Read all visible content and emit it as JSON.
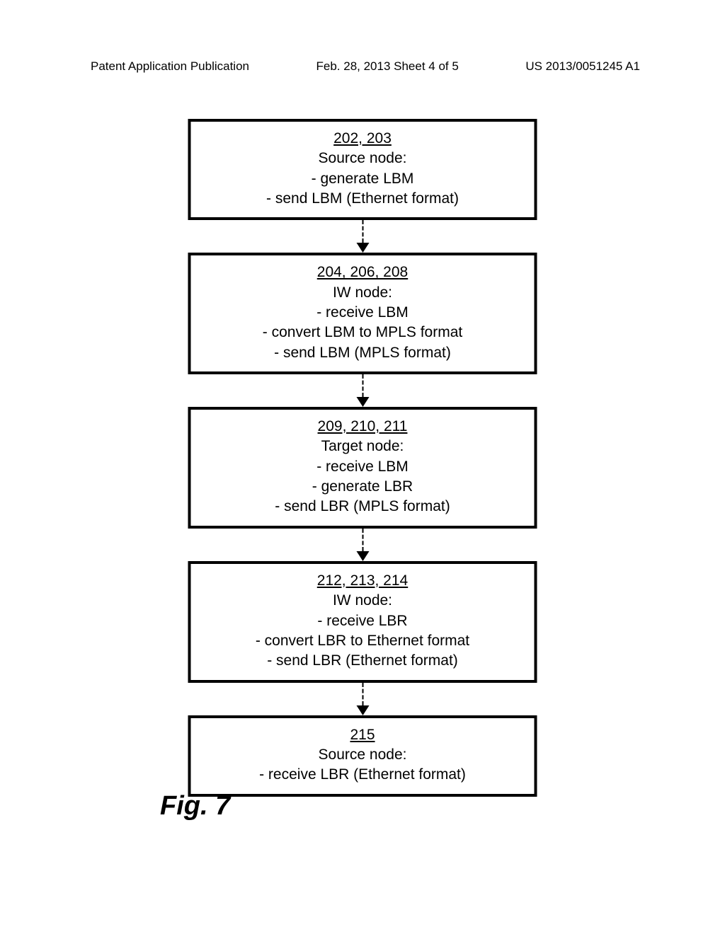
{
  "header": {
    "left": "Patent Application Publication",
    "center": "Feb. 28, 2013  Sheet 4 of 5",
    "right": "US 2013/0051245 A1"
  },
  "boxes": [
    {
      "ref": "202, 203",
      "node": "Source node:",
      "lines": [
        "- generate LBM",
        "- send LBM (Ethernet format)"
      ]
    },
    {
      "ref": "204, 206, 208",
      "node": "IW node:",
      "lines": [
        "- receive LBM",
        "- convert LBM to MPLS format",
        "- send LBM (MPLS format)"
      ]
    },
    {
      "ref": "209, 210, 211",
      "node": "Target node:",
      "lines": [
        "- receive LBM",
        "- generate LBR",
        "- send LBR (MPLS format)"
      ]
    },
    {
      "ref": "212, 213, 214",
      "node": "IW node:",
      "lines": [
        "- receive LBR",
        "- convert LBR to Ethernet format",
        "- send LBR (Ethernet format)"
      ]
    },
    {
      "ref": "215",
      "node": "Source node:",
      "lines": [
        "- receive LBR (Ethernet format)"
      ]
    }
  ],
  "figure_label": "Fig. 7"
}
